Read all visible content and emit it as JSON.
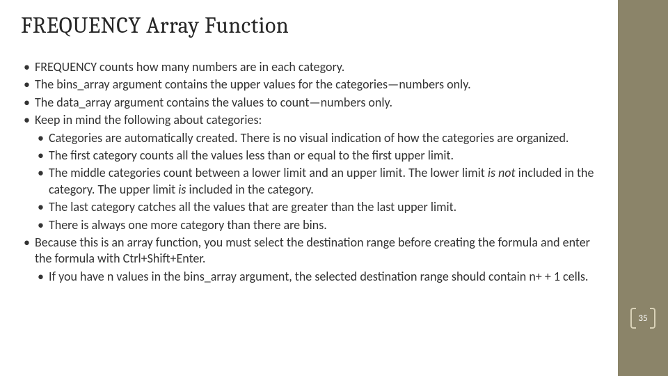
{
  "title": "FREQUENCY Array Function",
  "bullets": [
    {
      "text": "FREQUENCY counts how many numbers are in each category."
    },
    {
      "text": "The bins_array argument contains the upper values for the categories—numbers only."
    },
    {
      "text": "The data_array argument contains the values to count—numbers only."
    },
    {
      "text": "Keep in mind the following about categories:",
      "sub": [
        "Categories are automatically created. There is no visual indication of how the categories are organized.",
        "The first category counts all the values less than or equal to the first upper limit.",
        "__MIDDLE__",
        "The last category catches all the values that are greater than the last upper limit.",
        "There is always one more category than there are bins."
      ]
    },
    {
      "text": "Because this is an array function, you must select the destination range before creating the formula and enter the formula with Ctrl+Shift+Enter.",
      "sub": [
        "If you have n values in the bins_array argument, the selected destination range should contain n+ + 1 cells."
      ]
    }
  ],
  "mixed": {
    "pre": "The middle categories count between a lower limit and an upper limit. The lower limit ",
    "is1": "is not",
    "mid": " included in the category. The upper limit ",
    "is2": "is",
    "post": " included in the category."
  },
  "page": "35"
}
